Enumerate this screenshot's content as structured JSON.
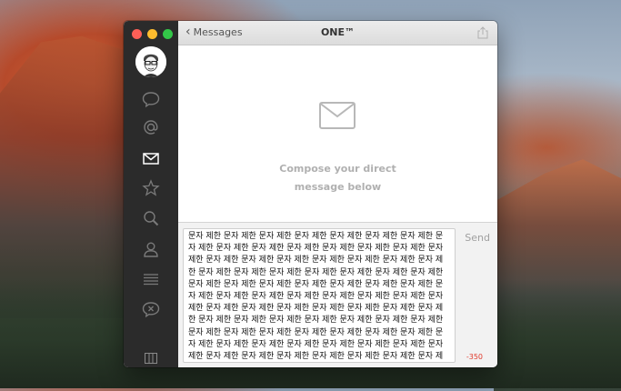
{
  "window": {
    "title": "ONE™",
    "back_label": "Messages"
  },
  "sidebar": {
    "items": [
      {
        "icon": "speech-bubble-icon"
      },
      {
        "icon": "at-sign-icon"
      },
      {
        "icon": "envelope-icon",
        "active": true
      },
      {
        "icon": "star-icon"
      },
      {
        "icon": "magnifier-icon"
      },
      {
        "icon": "person-icon"
      },
      {
        "icon": "list-icon"
      },
      {
        "icon": "muted-bubble-icon"
      }
    ]
  },
  "empty_state": {
    "line1": "Compose your direct",
    "line2": "message below"
  },
  "composer": {
    "text": "문자 제한 문자 제한 문자 제한 문자 제한 문자 제한 문자 제한 문자 제한 문자 제한 문자 제한 문자 제한 문자 제한 문자 제한 문자 제한 문자 제한 문자 제한 문자 제한 문자 제한 문자 제한 문자 제한 문자 제한 문자 제한 문자 제한 문자 제한 문자 제한 문자 제한 문자 제한 문자 제한 문자 제한 문자 제한 문자 제한 문자 제한 문자 제한 문자 제한 문자 제한 문자 제한 문자 제한 문자 제한 문자 제한 문자 제한 문자 제한 문자 제한 문자 제한 문자 제한 문자 제한 문자 제한 문자 제한 문자 제한 문자 제한 문자 제한 문자 제한 문자 제한 문자 제한 문자 제한 문자 제한 문자 제한 문자 제한 문자 제한 문자 제한 문자 제한 문자 제한 문자 제한 문자 제한 문자 제한 문자 제한 문자 제한 문자 제한 문자 제한 문자 제한 문자 제한 문자 제한 문자 제한 문자 제한 문자 제한 문자 제한 문자 제한 문자 제한 문자 제한 문자 제한 문자 제한 문자 제한 문자 제한 문자 제한 문자 제한 문자 제한 문자 제한 문자 제한 문자 제한 문자 제한 문자 제한 문자 제한 문자 제한 문자 제한 문자 제한 문자 제한 문자 제한 문자 제한 문자 제한 문자 제한 문자 제한 문자 제한 문자 제한 문자 제한 문자 제한 문자 제한 문자 제한 문자 제한 문자 제한 문자 제한 문자 제한 문자 제한 문자 제한 문자 제한 문자 제한 문자 제한 문자 제한 문자 제한 문자 제한 문자 제한 문자 제한 문자 제한 문자 제한 문자 제한 문자 제한 문자 제한 문자 제한 문자 제한 문자 제한 문자 제한 문자 제한 문자 제한 문자 제한 문자 제한 문자 제한 문자 제한 문자 제한 문자 제한 문자 제한 문자 제한 문자 제한 문자 제한 문자 제한 문자 제한 문자 제",
    "send_label": "Send",
    "counter": "-350"
  },
  "colors": {
    "counter_red": "#e0392b",
    "sidebar_bg": "#2b2b2b"
  }
}
